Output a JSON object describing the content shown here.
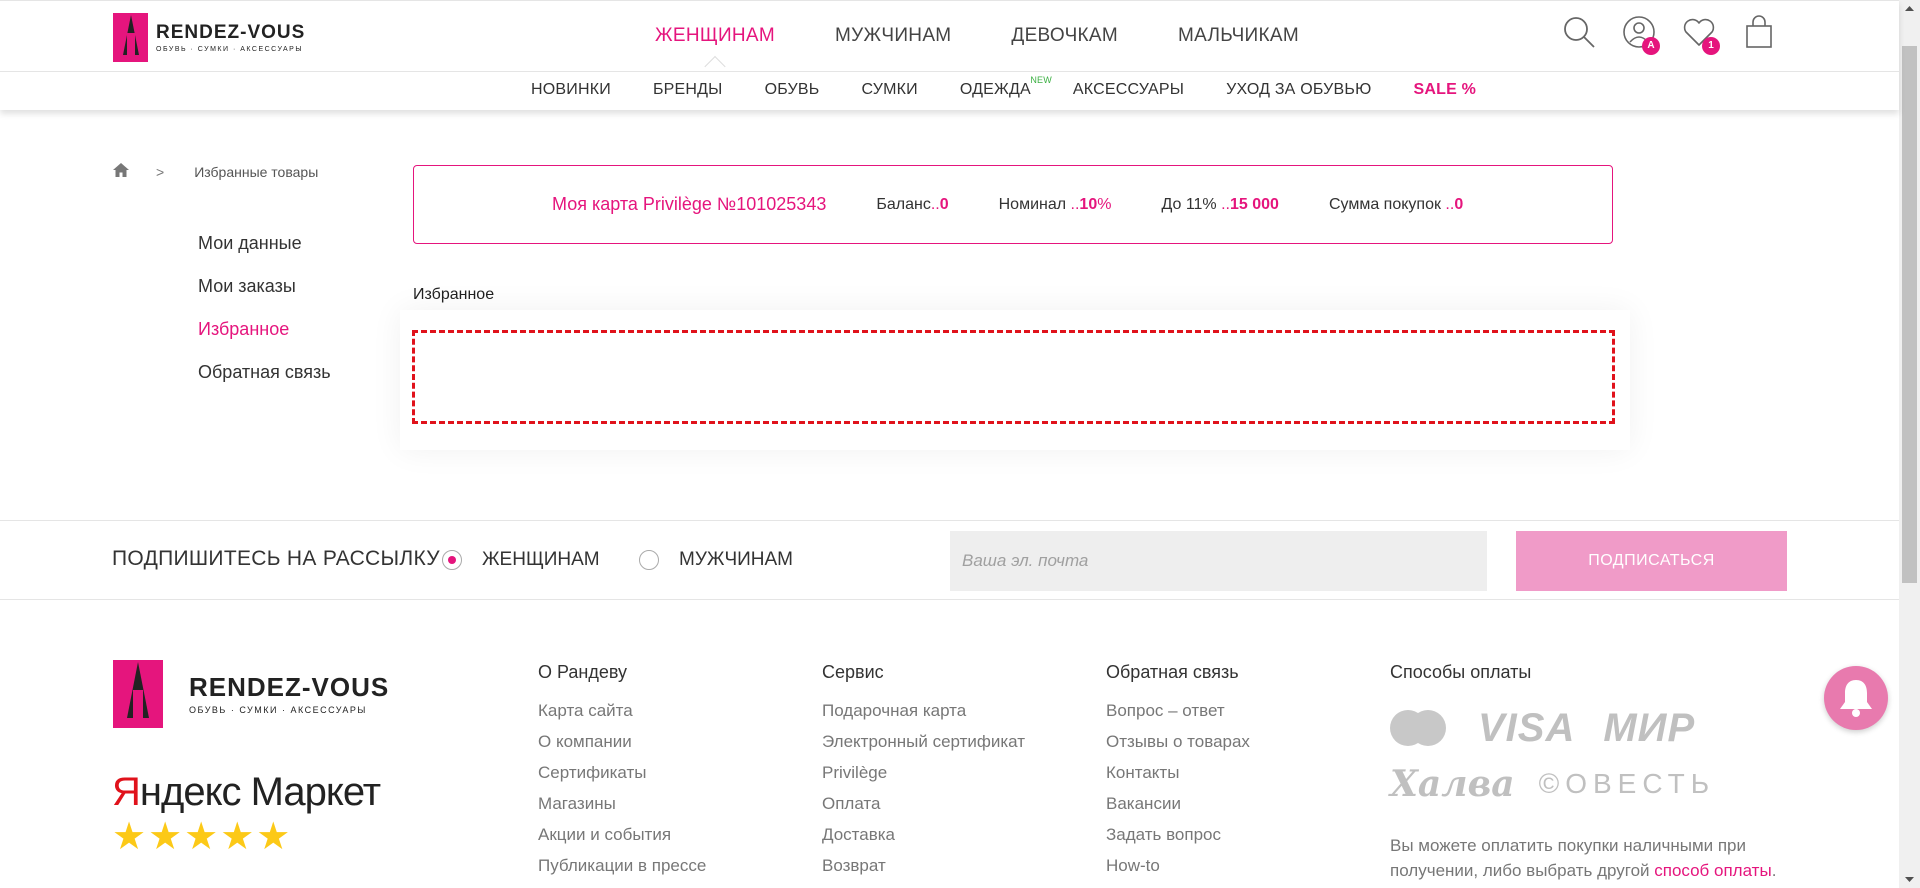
{
  "header": {
    "logo_name": "RENDEZ-VOUS",
    "logo_sub": "ОБУВЬ · СУМКИ · АКСЕССУАРЫ",
    "main_nav": [
      "ЖЕНЩИНАМ",
      "МУЖЧИНАМ",
      "ДЕВОЧКАМ",
      "МАЛЬЧИКАМ"
    ],
    "icons": {
      "account_badge": "A",
      "favorites_badge": "1"
    },
    "sub_nav": [
      {
        "label": "НОВИНКИ"
      },
      {
        "label": "БРЕНДЫ"
      },
      {
        "label": "ОБУВЬ"
      },
      {
        "label": "СУМКИ"
      },
      {
        "label": "ОДЕЖДА",
        "tag": "NEW"
      },
      {
        "label": "АКСЕССУАРЫ"
      },
      {
        "label": "УХОД ЗА ОБУВЬЮ"
      },
      {
        "label": "SALE %"
      }
    ]
  },
  "breadcrumb": {
    "separator": ">",
    "current": "Избранные товары"
  },
  "sidebar": {
    "items": [
      "Мои данные",
      "Мои заказы",
      "Избранное",
      "Обратная связь"
    ]
  },
  "card": {
    "title": "Моя карта Privilège №101025343",
    "balance_label": "Баланс",
    "balance_value": "0",
    "nominal_label": "Номинал",
    "nominal_value": "10",
    "nominal_unit": "%",
    "upto_label": "До 11%",
    "upto_value": "15 000",
    "purchases_label": "Сумма покупок",
    "purchases_value": "0",
    "dots": ".."
  },
  "favorites": {
    "title": "Избранное"
  },
  "subscribe": {
    "title": "ПОДПИШИТЕСЬ НА РАССЫЛКУ",
    "option_women": "ЖЕНЩИНАМ",
    "option_men": "МУЖЧИНАМ",
    "email_placeholder": "Ваша эл. почта",
    "button": "ПОДПИСАТЬСЯ"
  },
  "footer": {
    "market": {
      "y": "Я",
      "rest_a": "ндекс",
      "rest_b": " Маркет",
      "stars": "★★★★★"
    },
    "columns": [
      {
        "title": "О Рандеву",
        "links": [
          "Карта сайта",
          "О компании",
          "Сертификаты",
          "Магазины",
          "Акции и события",
          "Публикации в прессе"
        ]
      },
      {
        "title": "Сервис",
        "links": [
          "Подарочная карта",
          "Электронный сертификат",
          "Privilège",
          "Оплата",
          "Доставка",
          "Возврат"
        ]
      },
      {
        "title": "Обратная связь",
        "links": [
          "Вопрос – ответ",
          "Отзывы о товарах",
          "Контакты",
          "Вакансии",
          "Задать вопрос",
          "How-to"
        ]
      }
    ],
    "payment": {
      "title": "Способы оплаты",
      "visa": "VISA",
      "mir": "МИР",
      "halva": "Халва",
      "sovest": "©ОВЕСТЬ",
      "note_text": "Вы можете оплатить покупки наличными при получении, либо выбрать другой ",
      "note_link": "способ оплаты",
      "note_end": "."
    }
  },
  "colors": {
    "accent": "#e5157d",
    "button_subscribe": "#f09bc8",
    "dashed_border": "#e0121b",
    "stars": "#fcc917"
  }
}
